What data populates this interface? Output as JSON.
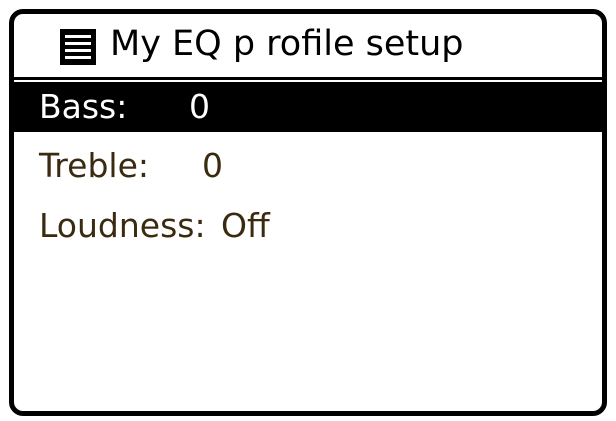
{
  "screen": {
    "title": "My EQ p rofile setup",
    "icon": "menu-list-icon"
  },
  "menu": {
    "items": [
      {
        "label": "Bass:",
        "value": "0",
        "selected": true
      },
      {
        "label": "Treble:",
        "value": "0",
        "selected": false
      },
      {
        "label": "Loudness:",
        "value": "Off",
        "selected": false
      }
    ]
  },
  "colors": {
    "border": "#000000",
    "highlight_bg": "#000000",
    "highlight_text": "#ffffff",
    "item_text": "#3a2a10"
  }
}
